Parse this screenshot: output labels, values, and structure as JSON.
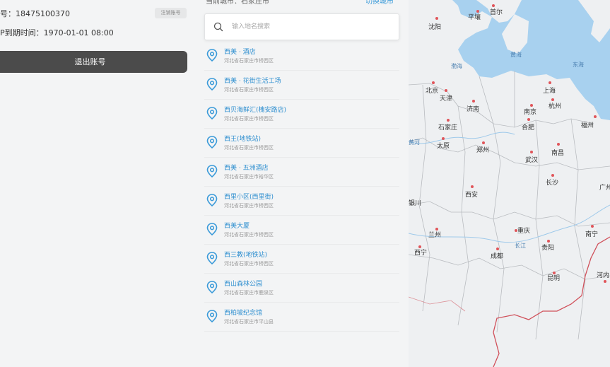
{
  "account": {
    "phone_text": "号：18475100370",
    "vip_text": "P到期时间：1970-01-01 08:00",
    "cancel_label": "注销账号",
    "logout_label": "退出账号"
  },
  "search": {
    "current_city": "当前城市：石家庄市",
    "switch_city": "切换城市",
    "placeholder": "输入地名搜索",
    "value": ""
  },
  "results": [
    {
      "name": "西美 · 酒店",
      "address": "河北省石家庄市桥西区"
    },
    {
      "name": "西美 · 花街生活工场",
      "address": "河北省石家庄市桥西区"
    },
    {
      "name": "西贝海鲜汇(槐安路店)",
      "address": "河北省石家庄市桥西区"
    },
    {
      "name": "西王(地铁站)",
      "address": "河北省石家庄市桥西区"
    },
    {
      "name": "西美 · 五洲酒店",
      "address": "河北省石家庄市裕华区"
    },
    {
      "name": "西里小区(西里街)",
      "address": "河北省石家庄市桥西区"
    },
    {
      "name": "西美大厦",
      "address": "河北省石家庄市桥西区"
    },
    {
      "name": "西三教(地铁站)",
      "address": "河北省石家庄市桥西区"
    },
    {
      "name": "西山森林公园",
      "address": "河北省石家庄市鹿泉区"
    },
    {
      "name": "西柏坡纪念馆",
      "address": "河北省石家庄市平山县"
    }
  ],
  "map": {
    "cities": [
      {
        "name": "平壤"
      },
      {
        "name": "首尔"
      },
      {
        "name": "沈阳"
      },
      {
        "name": "北京"
      },
      {
        "name": "天津"
      },
      {
        "name": "济南"
      },
      {
        "name": "上海"
      },
      {
        "name": "南京"
      },
      {
        "name": "杭州"
      },
      {
        "name": "石家庄"
      },
      {
        "name": "合肥"
      },
      {
        "name": "太原"
      },
      {
        "name": "郑州"
      },
      {
        "name": "福州"
      },
      {
        "name": "南昌"
      },
      {
        "name": "武汉"
      },
      {
        "name": "西安"
      },
      {
        "name": "长沙"
      },
      {
        "name": "兰州"
      },
      {
        "name": "重庆"
      },
      {
        "name": "西宁"
      },
      {
        "name": "成都"
      },
      {
        "name": "贵阳"
      },
      {
        "name": "南宁"
      },
      {
        "name": "昆明"
      },
      {
        "name": "银川"
      },
      {
        "name": "广州"
      },
      {
        "name": "河内"
      }
    ],
    "seas": [
      {
        "name": "渤海"
      },
      {
        "name": "黄海"
      },
      {
        "name": "东海"
      },
      {
        "name": "长江"
      },
      {
        "name": "黄河"
      }
    ],
    "colors": {
      "water": "#a8d1ef",
      "land": "#eef0f2",
      "border": "#d0505a",
      "province": "#b9bcc0"
    }
  }
}
